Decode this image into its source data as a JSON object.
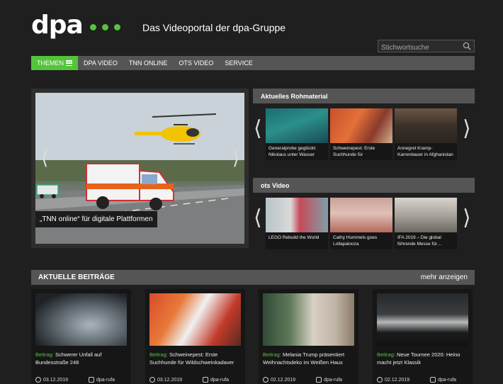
{
  "header": {
    "logo": "dpa",
    "tagline": "Das Videoportal der dpa-Gruppe",
    "search_placeholder": "Stichwortsuche"
  },
  "nav": {
    "themen": "THEMEN",
    "items": [
      "DPA VIDEO",
      "TNN ONLINE",
      "OTS VIDEO",
      "SERVICE"
    ]
  },
  "hero": {
    "caption": "„TNN online“ für digitale Plattformen"
  },
  "rohmaterial": {
    "title": "Aktuelles Rohmaterial",
    "items": [
      {
        "title": "Generalprobe geglückt: Nikolaus unter Wasser"
      },
      {
        "title": "Schweinepest: Erste Suchhunde für"
      },
      {
        "title": "Annegret Kramp-Karrenbauer in Afghanistan"
      }
    ]
  },
  "ots": {
    "title": "ots Video",
    "items": [
      {
        "title": "LEGO Rebuild the World"
      },
      {
        "title": "Cathy Hummels goes Lollapalooza"
      },
      {
        "title": "IFA 2019 – Die global führende Messe für…"
      }
    ]
  },
  "beitraege": {
    "title": "AKTUELLE BEITRÄGE",
    "more": "mehr anzeigen",
    "label": "Beitrag:",
    "cards": [
      {
        "title": "Schwerer Unfall auf Bundesstraße 248",
        "date": "03.12.2019",
        "source": "dpa-rufa"
      },
      {
        "title": "Schweinepest: Erste Suchhunde für Wildschweinkadaver",
        "date": "03.12.2019",
        "source": "dpa-rufa"
      },
      {
        "title": "Melania Trump präsentiert Weihnachtsdeko im Weißen Haus",
        "date": "02.12.2019",
        "source": "dpa-rufa"
      },
      {
        "title": "Neue Tournee 2020: Heino macht jetzt Klassik",
        "date": "02.12.2019",
        "source": "dpa-rufa"
      }
    ]
  },
  "colors": {
    "accent": "#54c43a",
    "bar": "#555555",
    "background": "#1f1f1f"
  }
}
